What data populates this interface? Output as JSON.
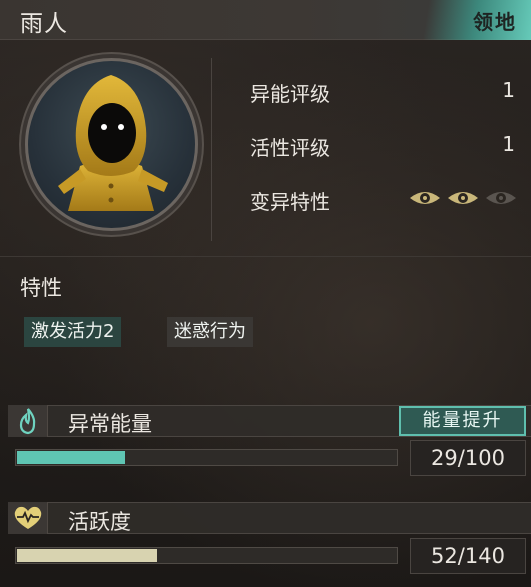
{
  "header": {
    "title": "雨人",
    "territory_label": "领地"
  },
  "portrait": {
    "icon": "raincoat-character-portrait"
  },
  "stats": [
    {
      "label": "异能评级",
      "value": "1"
    },
    {
      "label": "活性评级",
      "value": "1"
    },
    {
      "label": "变异特性",
      "eyes_active": 2,
      "eyes_total": 3
    }
  ],
  "traits": {
    "title": "特性",
    "tags": [
      "激发活力2",
      "迷惑行为"
    ]
  },
  "energy": {
    "icon": "flame-icon",
    "label": "异常能量",
    "button_label": "能量提升",
    "value_text": "29/100",
    "current": 29,
    "max": 100,
    "color": "#5fc5b3"
  },
  "activity": {
    "icon": "heartbeat-icon",
    "label": "活跃度",
    "value_text": "52/140",
    "current": 52,
    "max": 140,
    "color": "#d8d3b0"
  },
  "colors": {
    "accent": "#5fbfae",
    "gold": "#c9b77a"
  }
}
